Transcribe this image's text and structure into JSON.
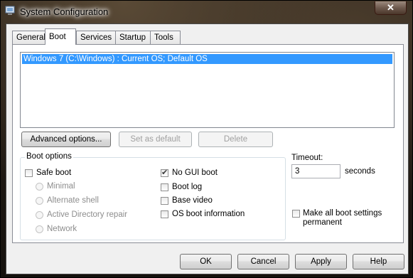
{
  "window": {
    "title": "System Configuration",
    "close_glyph": "✕"
  },
  "tabs": [
    {
      "label": "General"
    },
    {
      "label": "Boot",
      "active": true
    },
    {
      "label": "Services"
    },
    {
      "label": "Startup"
    },
    {
      "label": "Tools"
    }
  ],
  "os_list": [
    "Windows 7 (C:\\Windows) : Current OS; Default OS"
  ],
  "actions": {
    "advanced": "Advanced options...",
    "set_default": "Set as default",
    "delete": "Delete"
  },
  "boot_options": {
    "title": "Boot options",
    "safe_boot": {
      "label": "Safe boot",
      "checked": false
    },
    "radios": [
      "Minimal",
      "Alternate shell",
      "Active Directory repair",
      "Network"
    ],
    "no_gui_boot": {
      "label": "No GUI boot",
      "checked": true
    },
    "boot_log": {
      "label": "Boot log",
      "checked": false
    },
    "base_video": {
      "label": "Base video",
      "checked": false
    },
    "os_boot_info": {
      "label": "OS boot information",
      "checked": false
    }
  },
  "timeout": {
    "label": "Timeout:",
    "value": "3",
    "unit": "seconds"
  },
  "permanent": {
    "line1": "Make all boot settings",
    "line2": "permanent",
    "checked": false
  },
  "footer": {
    "ok": "OK",
    "cancel": "Cancel",
    "apply": "Apply",
    "help": "Help"
  },
  "colors": {
    "selection": "#3399ff",
    "window_face": "#f0f0f0"
  }
}
